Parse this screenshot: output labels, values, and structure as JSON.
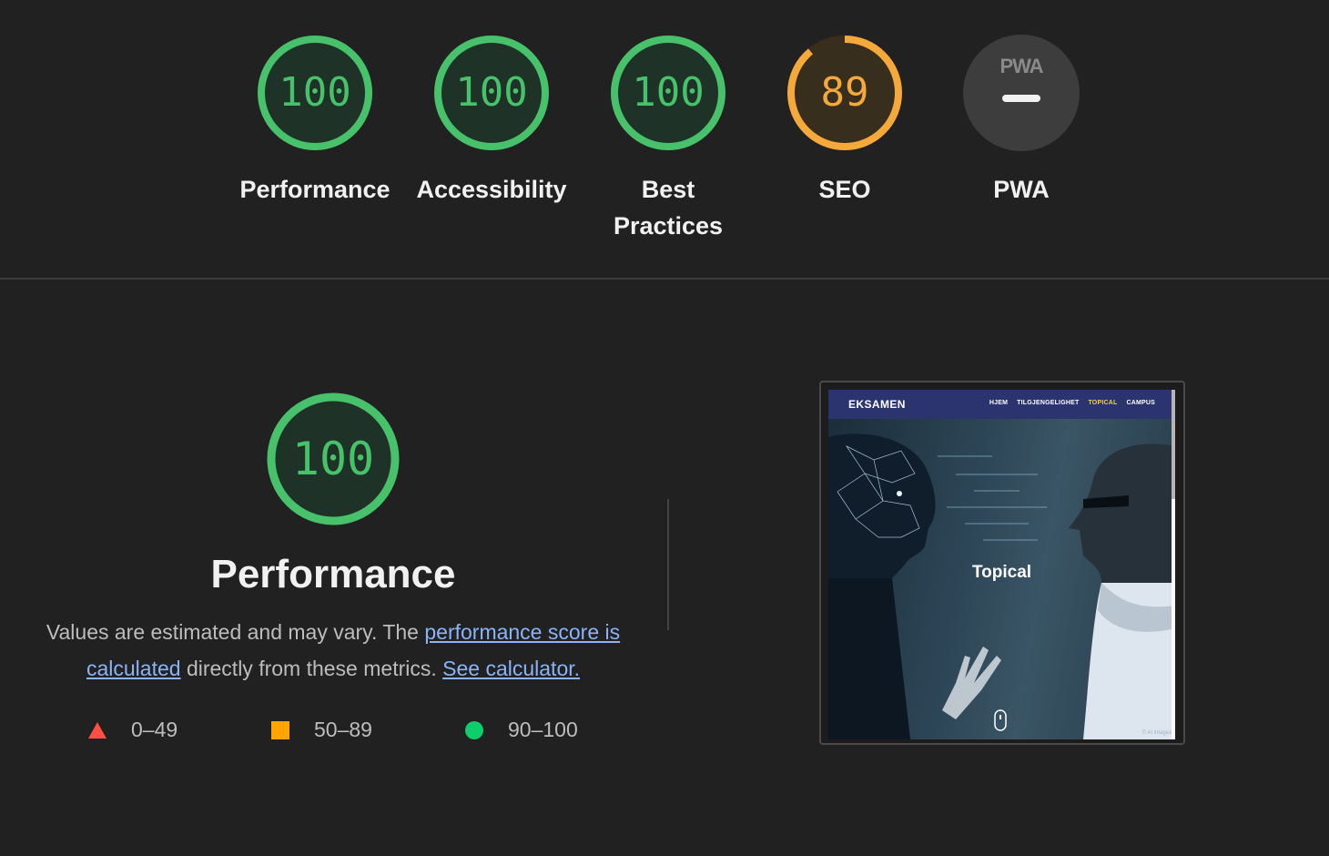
{
  "categories": [
    {
      "label": "Performance",
      "score": "100",
      "color": "#0cce6b"
    },
    {
      "label": "Accessibility",
      "score": "100",
      "color": "#0cce6b"
    },
    {
      "label": "Best Practices",
      "score": "100",
      "color": "#0cce6b"
    },
    {
      "label": "SEO",
      "score": "89",
      "color": "#ffa400"
    },
    {
      "label": "PWA",
      "badge": "PWA",
      "score": null,
      "color": "#f1f1f1"
    }
  ],
  "performance": {
    "score": "100",
    "title": "Performance",
    "desc_prefix": "Values are estimated and may vary. The ",
    "link_score": "performance score is calculated",
    "desc_middle": " directly from these metrics. ",
    "link_calc": "See calculator."
  },
  "legend": [
    {
      "range": "0–49",
      "shape": "triangle",
      "color": "#ff4e42"
    },
    {
      "range": "50–89",
      "shape": "square",
      "color": "#ffa400"
    },
    {
      "range": "90–100",
      "shape": "circle",
      "color": "#0cce6b"
    }
  ],
  "screenshot": {
    "brand": "EKSAMEN",
    "nav": [
      "HJEM",
      "TILGJENGELIGHET",
      "TOPICAL",
      "CAMPUS"
    ],
    "active_nav": "TOPICAL",
    "hero_title": "Topical",
    "credit": "© AI images"
  }
}
